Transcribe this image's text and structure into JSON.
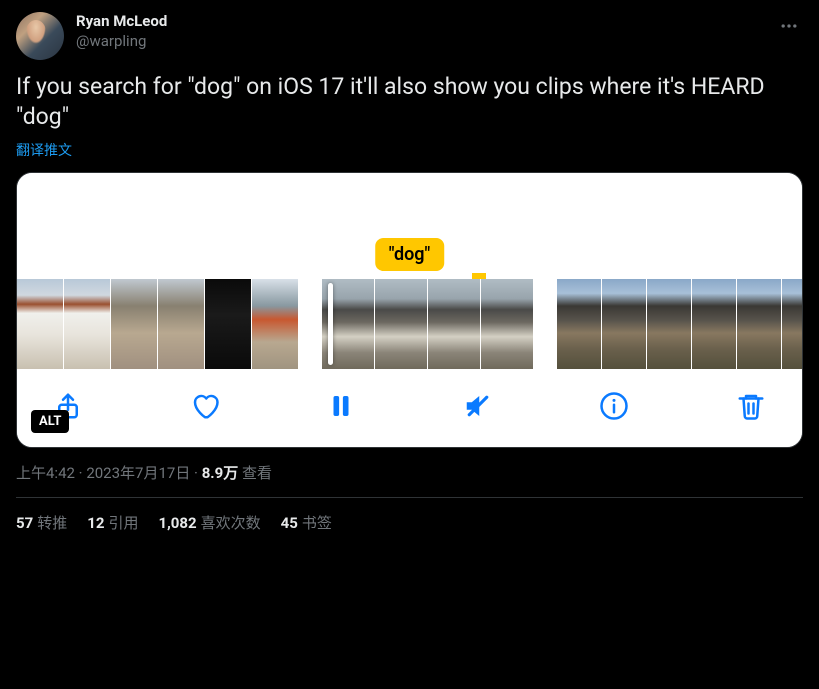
{
  "author": {
    "display_name": "Ryan McLeod",
    "handle": "@warpling"
  },
  "tweet_text": "If you search for \"dog\" on iOS 17 it'll also show you clips where it's HEARD \"dog\"",
  "translate_label": "翻译推文",
  "search_badge": "\"dog\"",
  "alt_label": "ALT",
  "meta": {
    "time": "上午4:42",
    "sep1": " · ",
    "date": "2023年7月17日",
    "sep2": " · ",
    "views_count": "8.9万",
    "views_label": " 查看"
  },
  "stats": {
    "retweets": {
      "count": "57",
      "label": "转推"
    },
    "quotes": {
      "count": "12",
      "label": "引用"
    },
    "likes": {
      "count": "1,082",
      "label": "喜欢次数"
    },
    "bookmarks": {
      "count": "45",
      "label": "书签"
    }
  }
}
